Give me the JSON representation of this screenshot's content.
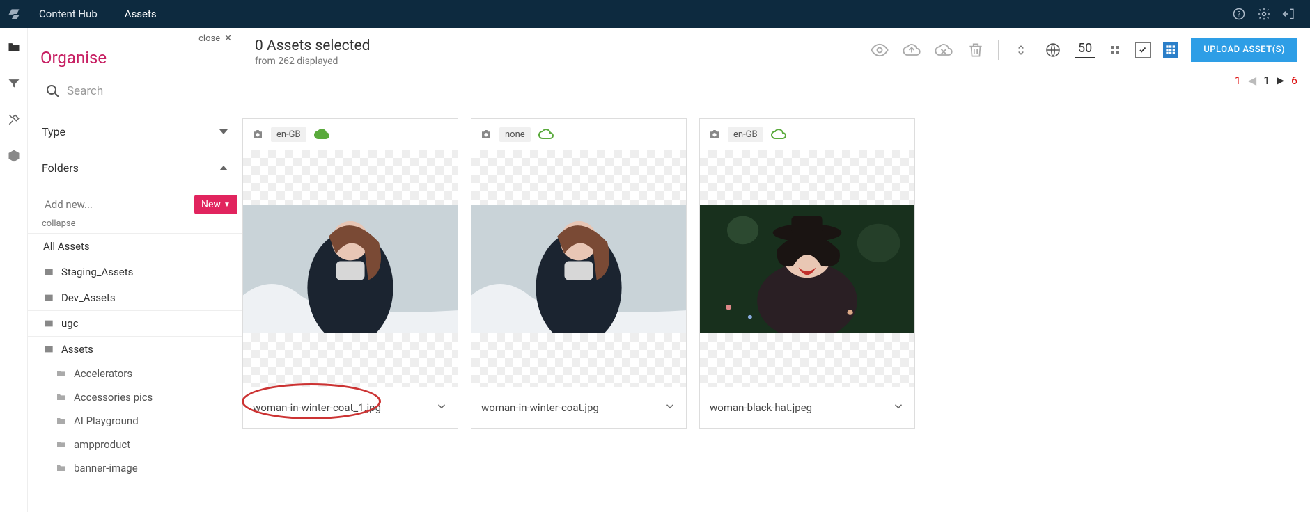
{
  "header": {
    "appTitle": "Content Hub",
    "tab": "Assets"
  },
  "panel": {
    "close": "close",
    "title": "Organise",
    "searchPlaceholder": "Search",
    "type": "Type",
    "folders": "Folders",
    "addPlaceholder": "Add new...",
    "newBtn": "New",
    "collapse": "collapse",
    "roots": [
      {
        "label": "All Assets",
        "icon": false
      },
      {
        "label": "Staging_Assets",
        "icon": true
      },
      {
        "label": "Dev_Assets",
        "icon": true
      },
      {
        "label": "ugc",
        "icon": true
      },
      {
        "label": "Assets",
        "icon": true
      }
    ],
    "subs": [
      "Accelerators",
      "Accessories pics",
      "AI Playground",
      "ampproduct",
      "banner-image"
    ]
  },
  "main": {
    "selected": "0 Assets selected",
    "displayed": "from 262 displayed",
    "pagesize": "50",
    "uploadLabel": "UPLOAD ASSET(S)",
    "pager": {
      "cur": "1",
      "pages": "1",
      "total": "6"
    }
  },
  "cards": [
    {
      "locale": "en-GB",
      "publish": "green-solid",
      "name": "woman-in-winter-coat_1.jpg",
      "img": "winter",
      "annot": true
    },
    {
      "locale": "none",
      "publish": "green-outline",
      "name": "woman-in-winter-coat.jpg",
      "img": "winter",
      "annot": false
    },
    {
      "locale": "en-GB",
      "publish": "green-outline",
      "name": "woman-black-hat.jpeg",
      "img": "hat",
      "annot": false
    }
  ]
}
